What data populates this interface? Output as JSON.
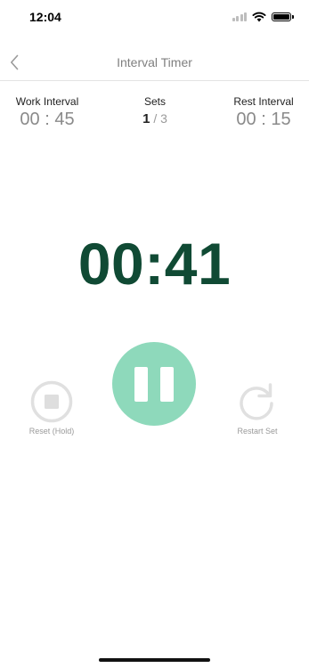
{
  "status_bar": {
    "time": "12:04"
  },
  "nav": {
    "title": "Interval Timer",
    "back_icon": "chevron-left-icon"
  },
  "stats": {
    "work_interval": {
      "label": "Work Interval",
      "value": "00 : 45"
    },
    "sets": {
      "label": "Sets",
      "current": "1",
      "separator": " / ",
      "total": "3"
    },
    "rest_interval": {
      "label": "Rest Interval",
      "value": "00 : 15"
    }
  },
  "timer": {
    "display": "00:41"
  },
  "controls": {
    "reset": {
      "label": "Reset (Hold)",
      "icon": "stop-icon"
    },
    "pause": {
      "icon": "pause-icon"
    },
    "restart": {
      "label": "Restart Set",
      "icon": "restart-icon"
    }
  },
  "colors": {
    "accent": "#8ed9bb",
    "timer": "#104a34",
    "muted": "#9a9a9a"
  }
}
